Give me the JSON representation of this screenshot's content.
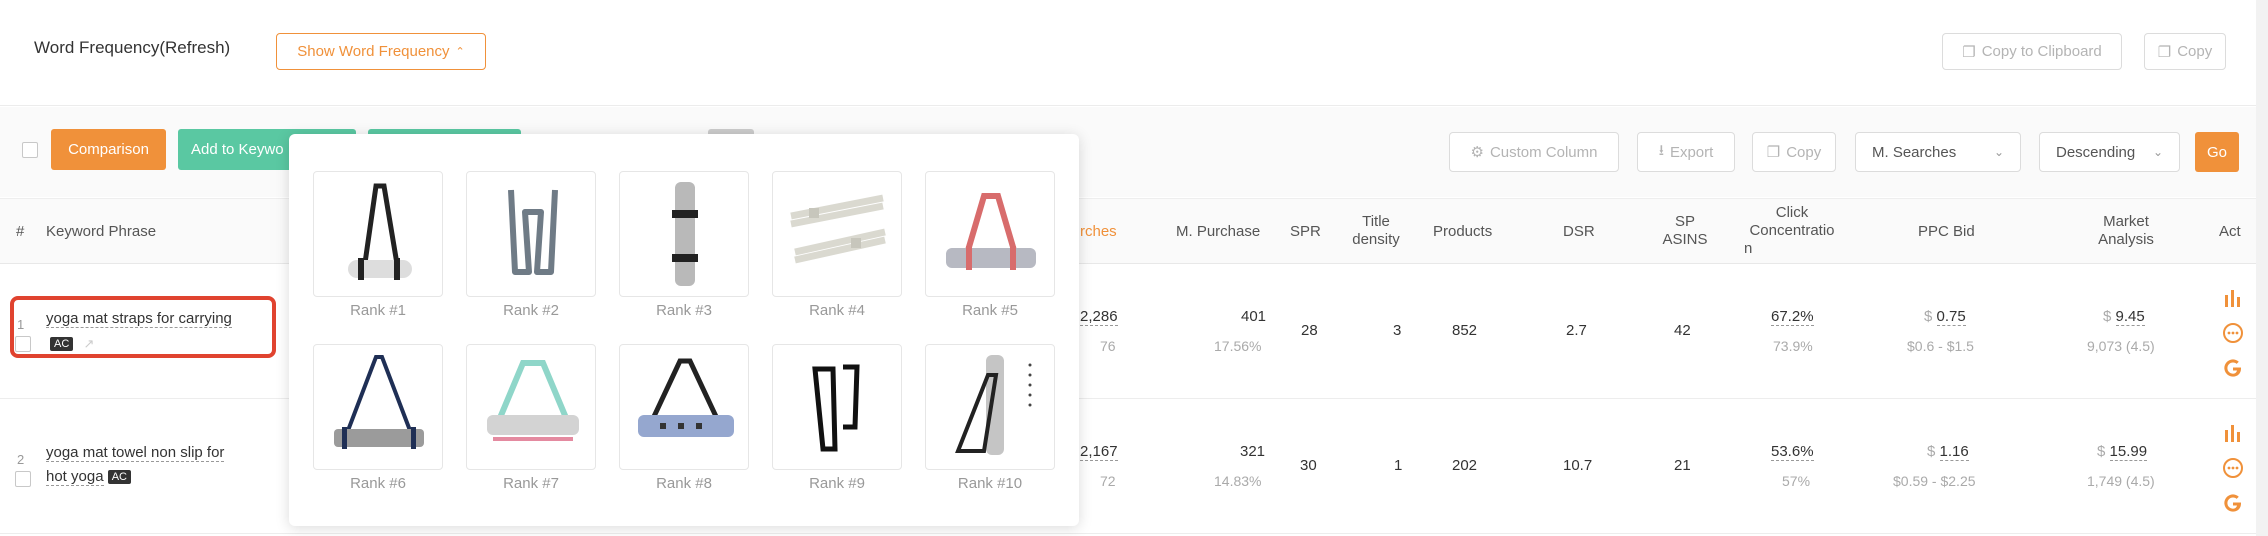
{
  "top": {
    "title": "Word Frequency(Refresh)",
    "show_word_frequency": "Show Word Frequency",
    "copy_to_clipboard": "Copy to Clipboard",
    "copy": "Copy"
  },
  "toolbar": {
    "comparison": "Comparison",
    "add_to_keyword": "Add to Keywo",
    "custom_column": "Custom Column",
    "export": "Export",
    "copy": "Copy",
    "sort_field": "M. Searches",
    "sort_order": "Descending",
    "go": "Go"
  },
  "headers": {
    "num": "#",
    "keyword": "Keyword Phrase",
    "searches": "rches",
    "purchase": "M. Purchase",
    "spr": "SPR",
    "title_density_1": "Title",
    "title_density_2": "density",
    "products": "Products",
    "dsr": "DSR",
    "sp_asins_1": "SP",
    "sp_asins_2": "ASINS",
    "click_1": "Click",
    "click_2": "Concentratio",
    "click_3": "n",
    "ppc": "PPC Bid",
    "market_1": "Market",
    "market_2": "Analysis",
    "act": "Act"
  },
  "rows": [
    {
      "num": "1",
      "keyword": "yoga mat straps for carrying",
      "badge": "AC",
      "searches": "2,286",
      "searches_sub": "76",
      "purchase": "401",
      "purchase_sub": "17.56%",
      "spr": "28",
      "title_density": "3",
      "products": "852",
      "dsr": "2.7",
      "sp_asins": "42",
      "click": "67.2%",
      "click_sub": "73.9%",
      "ppc_cur": "$",
      "ppc": "0.75",
      "ppc_sub": "$0.6 - $1.5",
      "market_cur": "$",
      "market": "9.45",
      "market_sub": "9,073 (4.5)"
    },
    {
      "num": "2",
      "keyword_1": "yoga mat towel non slip for",
      "keyword_2": "hot yoga",
      "badge": "AC",
      "searches": "2,167",
      "searches_sub": "72",
      "purchase": "321",
      "purchase_sub": "14.83%",
      "spr": "30",
      "title_density": "1",
      "products": "202",
      "dsr": "10.7",
      "sp_asins": "21",
      "click": "53.6%",
      "click_sub": "57%",
      "ppc_cur": "$",
      "ppc": "1.16",
      "ppc_sub": "$0.59 - $2.25",
      "market_cur": "$",
      "market": "15.99",
      "market_sub": "1,749 (4.5)"
    }
  ],
  "popup": {
    "ranks": [
      "Rank #1",
      "Rank #2",
      "Rank #3",
      "Rank #4",
      "Rank #5",
      "Rank #6",
      "Rank #7",
      "Rank #8",
      "Rank #9",
      "Rank #10"
    ]
  },
  "colors": {
    "orange": "#f0913a",
    "green": "#5ac8a2",
    "highlight": "#e0432f"
  }
}
